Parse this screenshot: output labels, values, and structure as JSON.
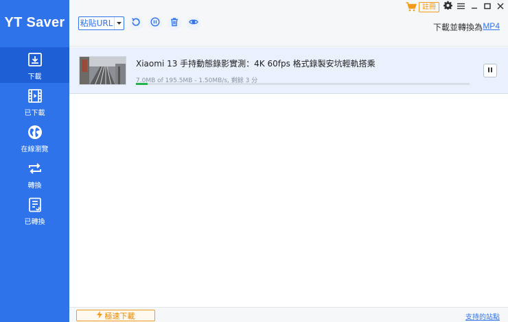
{
  "app": {
    "title": "YT Saver"
  },
  "sidebar": {
    "items": [
      {
        "label": "下載",
        "icon": "download-icon",
        "active": true
      },
      {
        "label": "已下載",
        "icon": "film-icon",
        "active": false
      },
      {
        "label": "在線瀏覽",
        "icon": "globe-icon",
        "active": false
      },
      {
        "label": "轉換",
        "icon": "convert-icon",
        "active": false
      },
      {
        "label": "已轉換",
        "icon": "converted-document-icon",
        "active": false
      }
    ]
  },
  "toolbar": {
    "paste_label": "粘貼URL",
    "convert_label": "下載並轉換為",
    "convert_format": "MP4",
    "register_label": "註冊"
  },
  "download": {
    "title": "Xiaomi 13 手持動態錄影實測：4K 60fps 格式錄製安坑輕軌搭乘",
    "stats": "7.0MB of 195.5MB -    1.50MB/s, 剩餘 3 分",
    "progress_fraction": 0.036
  },
  "footer": {
    "turbo_label": "極速下載",
    "sites_link": "支持的站點"
  },
  "colors": {
    "sidebar_bg": "#2f73ea",
    "sidebar_active": "#1f5fd6",
    "accent": "#2f73ea",
    "orange": "#f29a1a",
    "progress": "#22b14c"
  }
}
